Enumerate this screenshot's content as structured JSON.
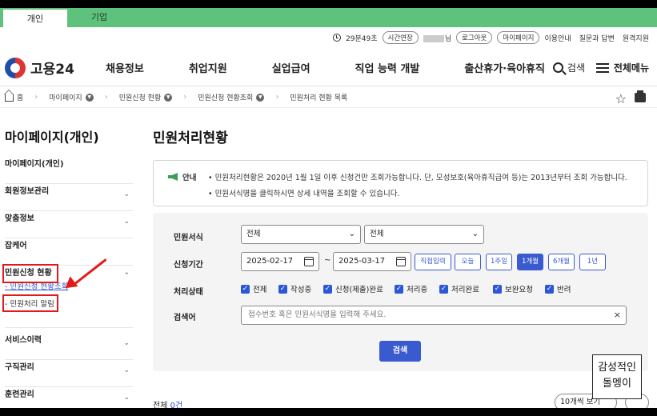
{
  "top_tabs": {
    "personal": "개인",
    "company": "기업"
  },
  "utility": {
    "time_left": "29분49초",
    "extend": "시간연장",
    "user_suffix": "님",
    "logout": "로그아웃",
    "mypage": "마이페이지",
    "guide": "이용안내",
    "qna": "질문과 답변",
    "remote": "원격지원"
  },
  "header": {
    "logo": "고용24",
    "gnb": [
      "채용정보",
      "취업지원",
      "실업급여",
      "직업 능력 개발",
      "출산휴가·육아휴직"
    ],
    "search": "검색",
    "menu": "전체메뉴"
  },
  "breadcrumb": {
    "home": "홈",
    "items": [
      "마이페이지",
      "민원신청 현황",
      "민원신청 현황조회",
      "민원처리 현황 목록"
    ]
  },
  "sidebar": {
    "title": "마이페이지(개인)",
    "items": [
      "마이페이지(개인)",
      "회원정보관리",
      "맞춤정보",
      "잡케어",
      "민원신청 현황",
      "서비스이력",
      "구직관리",
      "훈련관리"
    ],
    "sub_items": [
      "- 민원신청 현황조회",
      "- 민원처리 알림"
    ]
  },
  "main": {
    "title": "민원처리현황",
    "notice_label": "안내",
    "notice_lines": [
      "• 민원처리현황은 2020년 1월 1일 이후 신청건만 조회가능합니다. 단, 모성보호(육아휴직급여 등)는 2013년부터 조회 가능합니다.",
      "• 민원서식명을 클릭하시면 상세 내역을 조회할 수 있습니다."
    ],
    "form": {
      "label_form": "민원서식",
      "select1": "전체",
      "select2": "전체",
      "label_period": "신청기간",
      "date_from": "2025-02-17",
      "date_sep": "~",
      "date_to": "2025-03-17",
      "period_buttons": [
        "직접입력",
        "오늘",
        "1주일",
        "1개월",
        "6개월",
        "1년"
      ],
      "active_period": "1개월",
      "label_status": "처리상태",
      "statuses": [
        "전체",
        "작성중",
        "신청(제출)완료",
        "처리중",
        "처리완료",
        "보완요청",
        "반려"
      ],
      "label_keyword": "검색어",
      "keyword_placeholder": "접수번호 혹은 민원서식명을 입력해 주세요.",
      "search_button": "검색"
    },
    "total_label": "전체",
    "total_count": "0건",
    "page_size": "10개씩 보기"
  },
  "watermark": {
    "line1": "감성적인",
    "line2": "돌멩이"
  },
  "colors": {
    "brand_green": "#5fc27c",
    "primary_blue": "#3a5bd0",
    "annotation_red": "#e31a1a"
  }
}
